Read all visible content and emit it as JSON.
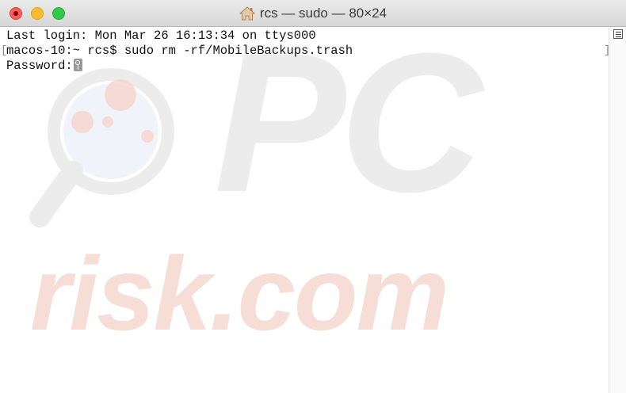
{
  "window": {
    "title": "rcs — sudo — 80×24"
  },
  "terminal": {
    "lines": [
      "Last login: Mon Mar 26 16:13:34 on ttys000",
      "macos-10:~ rcs$ sudo rm -rf/MobileBackups.trash",
      "Password:"
    ]
  },
  "watermark": {
    "top_text": "PC",
    "bottom_text": "risk.com"
  },
  "colors": {
    "close": "#fc5b57",
    "minimize": "#fdbc2f",
    "maximize": "#34c84a",
    "watermark_red": "#f4cfc4",
    "watermark_gray": "#ececec"
  },
  "icons": {
    "title_icon": "home-icon",
    "cursor_icon": "key-icon",
    "menu_icon": "hamburger-icon"
  }
}
